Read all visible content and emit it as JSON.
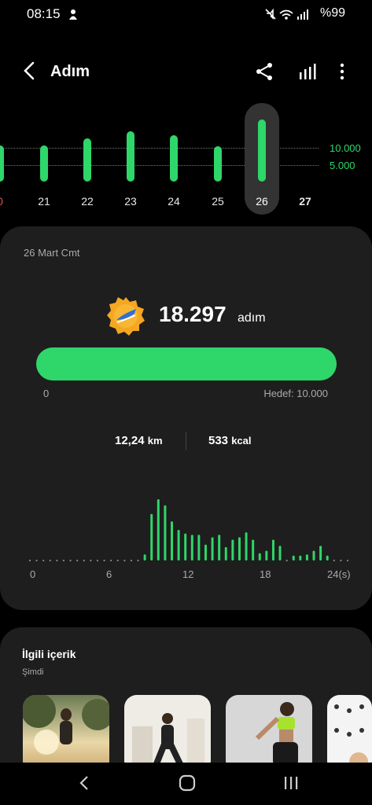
{
  "status": {
    "time": "08:15",
    "battery": "%99"
  },
  "header": {
    "title": "Adım"
  },
  "week_chart": {
    "y_labels": [
      "10.000",
      "5.000"
    ],
    "days": [
      {
        "label": "0",
        "steps": 10800,
        "selected": false
      },
      {
        "label": "21",
        "steps": 10800,
        "selected": false
      },
      {
        "label": "22",
        "steps": 12700,
        "selected": false
      },
      {
        "label": "23",
        "steps": 15000,
        "selected": false
      },
      {
        "label": "24",
        "steps": 13800,
        "selected": false
      },
      {
        "label": "25",
        "steps": 10400,
        "selected": false
      },
      {
        "label": "26",
        "steps": 18297,
        "selected": true
      },
      {
        "label": "27",
        "steps": 0,
        "selected": false
      }
    ]
  },
  "summary": {
    "date": "26 Mart Cmt",
    "steps": "18.297",
    "steps_unit": "adım",
    "progress": 1.0,
    "progress_min": "0",
    "goal": "Hedef: 10.000",
    "distance_value": "12,24",
    "distance_unit": "km",
    "calories_value": "533",
    "calories_unit": "kcal"
  },
  "hourly_chart": {
    "type": "bar",
    "x_ticks": [
      "0",
      "6",
      "12",
      "18",
      "24(s)"
    ],
    "values": [
      0,
      0,
      0,
      0,
      0,
      0,
      0,
      0,
      0,
      0,
      0,
      0,
      0,
      0,
      0,
      0,
      0,
      50,
      380,
      500,
      450,
      320,
      250,
      220,
      210,
      210,
      130,
      190,
      210,
      110,
      170,
      190,
      230,
      170,
      60,
      80,
      170,
      120,
      0,
      40,
      40,
      50,
      80,
      120,
      40,
      0,
      0,
      0
    ]
  },
  "related": {
    "title": "İlgili içerik",
    "subtitle": "Şimdi"
  },
  "colors": {
    "accent": "#2fd66a",
    "card": "#1e1e1e",
    "background": "#000000"
  }
}
